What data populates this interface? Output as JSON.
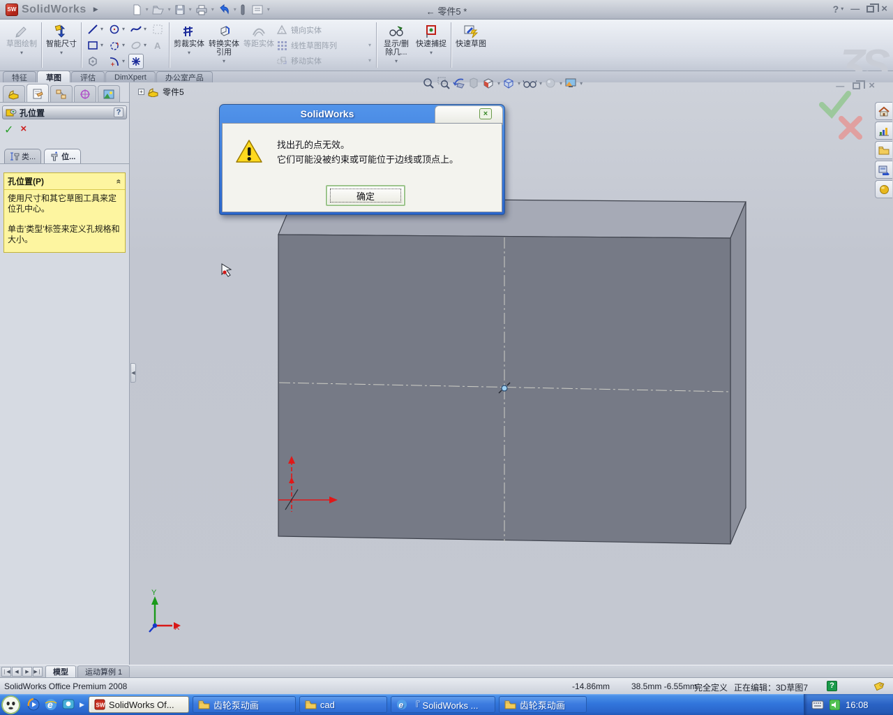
{
  "colors": {
    "taskbar_blue": "#3276dc",
    "dialog_title_blue": "#2a66cc",
    "panel_yellow": "#fdf5a0",
    "viewport_bg": "#c4c8d1",
    "box_front": "#767a86",
    "box_top": "#a6aab6",
    "box_side": "#8a8e9a",
    "warning_yellow": "#f6c80a",
    "confirm_green": "#9cc89c",
    "confirm_red": "#e0a0a0",
    "axis_red": "#e01818",
    "axis_green": "#1a9a1a",
    "axis_blue": "#1838c8"
  },
  "titlebar": {
    "app_name": "SolidWorks",
    "doc_title": "← 零件5 *"
  },
  "icons": {
    "dropdown": "▾",
    "menu_expand": "▶",
    "minimize": "—",
    "close": "×",
    "help": "?",
    "plus": "+",
    "collapse_left": "◀",
    "chevron_double": "«",
    "nav_first": "❘◀",
    "nav_prev": "◀",
    "nav_next": "▶",
    "nav_last": "▶❘",
    "check": "✓",
    "cross": "×",
    "watermark": "ƷS"
  },
  "toolbar": {
    "sketch": "草图绘制",
    "smart_dimension": "智能尺寸",
    "trim": "剪裁实体",
    "convert": "转换实体引用",
    "offset": "等距实体",
    "mirror": "镜向实体",
    "linear_pattern": "线性草图阵列",
    "move": "移动实体",
    "display_delete": "显示/删除几...",
    "quick_snap": "快速捕捉",
    "rapid_sketch": "快速草图"
  },
  "ribbon_tabs": [
    "特征",
    "草图",
    "评估",
    "DimXpert",
    "办公室产品"
  ],
  "feature_tree": {
    "root": "零件5"
  },
  "property_manager": {
    "title": "孔位置",
    "tab_type": "类...",
    "tab_position": "位...",
    "message_header": "孔位置(P)",
    "message_line1": "使用尺寸和其它草图工具来定位孔中心。",
    "message_line2": "单击'类型'标签来定义孔规格和大小。"
  },
  "dialog": {
    "title": "SolidWorks",
    "message_line1": "找出孔的点无效。",
    "message_line2": "它们可能没被约束或可能位于边线或顶点上。",
    "ok_label": "确定"
  },
  "viewport": {
    "axis_x": "X",
    "axis_y": "Y"
  },
  "bottom_tabs": {
    "model": "模型",
    "motion": "运动算例 1"
  },
  "statusbar": {
    "product": "SolidWorks Office Premium 2008",
    "coord_x": "-14.86mm",
    "coord_yz": "38.5mm -6.55mm",
    "define_state": "完全定义",
    "editing": "正在编辑：3D草图7"
  },
  "taskbar": {
    "tasks": [
      {
        "label": "SolidWorks Of..."
      },
      {
        "label": "齿轮泵动画"
      },
      {
        "label": "cad"
      },
      {
        "label": "『 SolidWorks ..."
      },
      {
        "label": "齿轮泵动画"
      }
    ],
    "time": "16:08"
  }
}
